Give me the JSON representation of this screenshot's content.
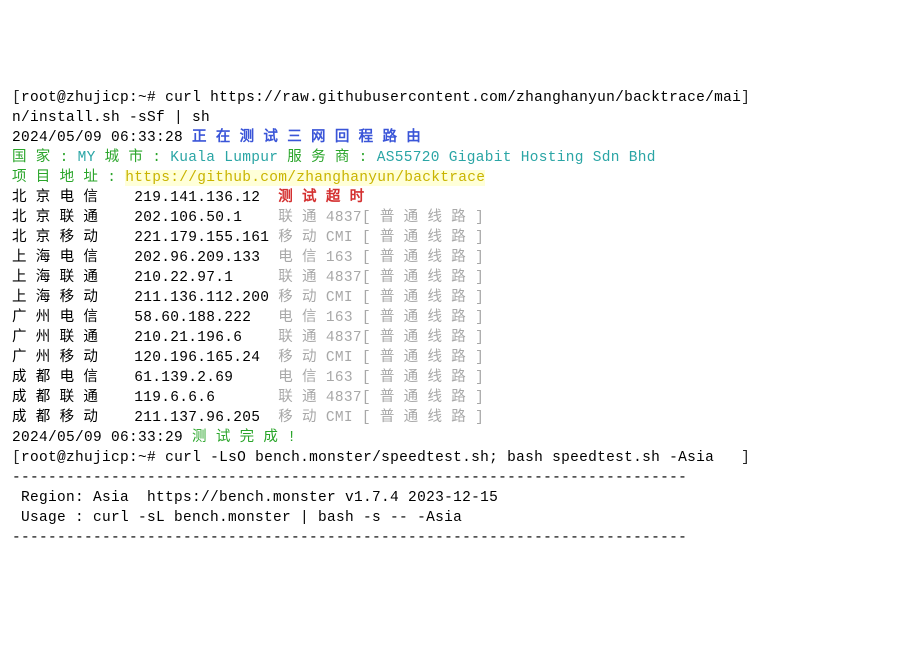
{
  "prompt1": {
    "bracket_open": "[",
    "user_host": "root@zhujicp",
    "colon_path": ":~#",
    "bracket_close": "]",
    "command": "curl https://raw.githubusercontent.com/zhanghanyun/backtrace/main/install.sh -sSf | sh"
  },
  "ts1": "2024/05/09 06:33:28",
  "testing_label": "正 在 测 试 三 网 回 程 路 由",
  "geo": {
    "country_label": "国 家 :",
    "country_value": "MY",
    "city_label": "城 市 :",
    "city_value": "Kuala Lumpur",
    "isp_label": "服 务 商 :",
    "isp_value": "AS55720 Gigabit Hosting Sdn Bhd"
  },
  "repo": {
    "label": "项 目 地 址 :",
    "url": "https://github.com/zhanghanyun/backtrace"
  },
  "routes": [
    {
      "name": "北 京 电 信",
      "ip": "219.141.136.12",
      "route": "测 试 超 时",
      "route_class": "red bold",
      "quality": ""
    },
    {
      "name": "北 京 联 通",
      "ip": "202.106.50.1",
      "route": "联 通 4837",
      "route_class": "grey",
      "quality": "[ 普 通 线 路 ]"
    },
    {
      "name": "北 京 移 动",
      "ip": "221.179.155.161",
      "route": "移 动 CMI ",
      "route_class": "grey",
      "quality": "[ 普 通 线 路 ]"
    },
    {
      "name": "上 海 电 信",
      "ip": "202.96.209.133",
      "route": "电 信 163 ",
      "route_class": "grey",
      "quality": "[ 普 通 线 路 ]"
    },
    {
      "name": "上 海 联 通",
      "ip": "210.22.97.1",
      "route": "联 通 4837",
      "route_class": "grey",
      "quality": "[ 普 通 线 路 ]"
    },
    {
      "name": "上 海 移 动",
      "ip": "211.136.112.200",
      "route": "移 动 CMI ",
      "route_class": "grey",
      "quality": "[ 普 通 线 路 ]"
    },
    {
      "name": "广 州 电 信",
      "ip": "58.60.188.222",
      "route": "电 信 163 ",
      "route_class": "grey",
      "quality": "[ 普 通 线 路 ]"
    },
    {
      "name": "广 州 联 通",
      "ip": "210.21.196.6",
      "route": "联 通 4837",
      "route_class": "grey",
      "quality": "[ 普 通 线 路 ]"
    },
    {
      "name": "广 州 移 动",
      "ip": "120.196.165.24",
      "route": "移 动 CMI ",
      "route_class": "grey",
      "quality": "[ 普 通 线 路 ]"
    },
    {
      "name": "成 都 电 信",
      "ip": "61.139.2.69",
      "route": "电 信 163 ",
      "route_class": "grey",
      "quality": "[ 普 通 线 路 ]"
    },
    {
      "name": "成 都 联 通",
      "ip": "119.6.6.6",
      "route": "联 通 4837",
      "route_class": "grey",
      "quality": "[ 普 通 线 路 ]"
    },
    {
      "name": "成 都 移 动",
      "ip": "211.137.96.205",
      "route": "移 动 CMI ",
      "route_class": "grey",
      "quality": "[ 普 通 线 路 ]"
    }
  ],
  "ts2": "2024/05/09 06:33:29",
  "done_label": "测 试 完 成 !",
  "prompt2": {
    "bracket_open": "[",
    "user_host": "root@zhujicp",
    "colon_path": ":~#",
    "bracket_close": "]",
    "command": "curl -LsO bench.monster/speedtest.sh; bash speedtest.sh -Asia"
  },
  "dash": "---------------------------------------------------------------------------",
  "region_line": " Region: Asia  https://bench.monster v1.7.4 2023-12-15",
  "usage_line": " Usage : curl -sL bench.monster | bash -s -- -Asia"
}
